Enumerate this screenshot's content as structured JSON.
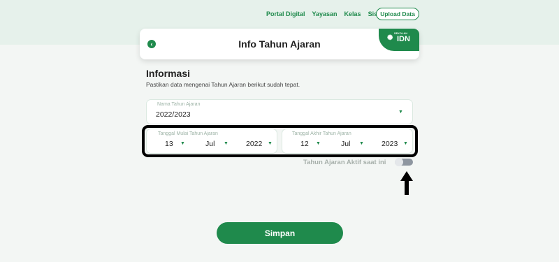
{
  "topnav": {
    "items": [
      "Portal Digital",
      "Yayasan",
      "Kelas",
      "Siswa"
    ],
    "upload_label": "Upload Data"
  },
  "header": {
    "title": "Info Tahun Ajaran",
    "back_icon": "chevron-left-icon",
    "brand_small": "SEKOLAH",
    "brand_name": "IDN",
    "brand_color": "#1f8a4c"
  },
  "section": {
    "title": "Informasi",
    "subtitle": "Pastikan data mengenai Tahun Ajaran berikut sudah tepat."
  },
  "nama_tahun_ajaran": {
    "label": "Nama Tahun Ajaran",
    "value": "2022/2023"
  },
  "tanggal_mulai": {
    "label": "Tanggal Mulai Tahun Ajaran",
    "day": "13",
    "month": "Jul",
    "year": "2022"
  },
  "tanggal_akhir": {
    "label": "Tanggal Akhir Tahun Ajaran",
    "day": "12",
    "month": "Jul",
    "year": "2023"
  },
  "aktif": {
    "label": "Tahun Ajaran Aktif saat ini",
    "on": false
  },
  "save_label": "Simpan",
  "caret_glyph": "▼"
}
